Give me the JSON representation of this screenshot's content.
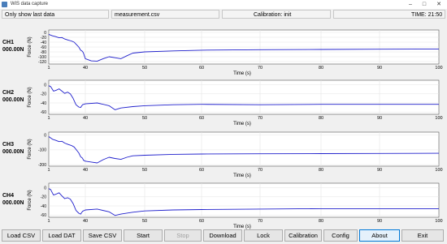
{
  "window": {
    "title": "WiS data capture",
    "minimize": "–",
    "maximize": "□",
    "close": "✕"
  },
  "status": {
    "mode": "Only show last data",
    "file": "measurement.csv",
    "calibration": "Calibration: init",
    "time": "TIME: 21:50"
  },
  "channels": [
    {
      "name": "CH1",
      "value": "000.00N",
      "ylabel": "Force (N)",
      "xlabel": "Time (s)",
      "yticks": [
        "0",
        "-20",
        "-40",
        "-60",
        "-80",
        "-100",
        "-120"
      ],
      "ylim": [
        -130,
        10
      ]
    },
    {
      "name": "CH2",
      "value": "000.00N",
      "ylabel": "Force (N)",
      "xlabel": "Time (s)",
      "yticks": [
        "0",
        "-20",
        "-40",
        "-60"
      ],
      "ylim": [
        -65,
        10
      ]
    },
    {
      "name": "CH3",
      "value": "000.00N",
      "ylabel": "Force (N)",
      "xlabel": "Time (s)",
      "yticks": [
        "0",
        "-100",
        "-200"
      ],
      "ylim": [
        -210,
        20
      ]
    },
    {
      "name": "CH4",
      "value": "000.00N",
      "ylabel": "Force (N)",
      "xlabel": "Time (s)",
      "yticks": [
        "0",
        "-20",
        "-40",
        "-60"
      ],
      "ylim": [
        -65,
        10
      ]
    }
  ],
  "xticks": [
    "1",
    "40",
    "50",
    "60",
    "70",
    "80",
    "90",
    "100"
  ],
  "colors": {
    "trace": "#1f1fcc",
    "grid": "#e4e4e4"
  },
  "buttons": [
    {
      "id": "load-csv",
      "label": "Load CSV"
    },
    {
      "id": "load-dat",
      "label": "Load DAT"
    },
    {
      "id": "save-csv",
      "label": "Save CSV"
    },
    {
      "id": "start",
      "label": "Start"
    },
    {
      "id": "stop",
      "label": "Stop"
    },
    {
      "id": "download",
      "label": "Download"
    },
    {
      "id": "lock",
      "label": "Lock"
    },
    {
      "id": "calibration",
      "label": "Calibration"
    },
    {
      "id": "config",
      "label": "Config"
    },
    {
      "id": "about",
      "label": "About"
    },
    {
      "id": "exit",
      "label": "Exit"
    }
  ],
  "chart_data": [
    {
      "type": "line",
      "title": "",
      "xlabel": "Time (s)",
      "ylabel": "Force (N)",
      "xlim": [
        1,
        100
      ],
      "ylim": [
        -130,
        10
      ],
      "series": [
        {
          "x": [
            1,
            5,
            8,
            12,
            15,
            18,
            22,
            25,
            28,
            31,
            33,
            35,
            37,
            38,
            40,
            41,
            42,
            43,
            44,
            45,
            46,
            47,
            48,
            50,
            55,
            60,
            70,
            80,
            90,
            100
          ],
          "y": [
            -8,
            -14,
            -17,
            -22,
            -21,
            -27,
            -32,
            -35,
            -40,
            -52,
            -60,
            -73,
            -78,
            -85,
            -108,
            -117,
            -118,
            -108,
            -100,
            -104,
            -108,
            -96,
            -85,
            -80,
            -76,
            -73,
            -71,
            -70,
            -69,
            -68
          ]
        }
      ]
    },
    {
      "type": "line",
      "title": "",
      "xlabel": "Time (s)",
      "ylabel": "Force (N)",
      "xlim": [
        1,
        100
      ],
      "ylim": [
        -65,
        10
      ],
      "series": [
        {
          "x": [
            1,
            3,
            6,
            9,
            12,
            15,
            18,
            21,
            24,
            27,
            30,
            33,
            35,
            37,
            40,
            42,
            44,
            45,
            46,
            48,
            50,
            55,
            60,
            70,
            80,
            90,
            100
          ],
          "y": [
            -2,
            -4,
            -14,
            -12,
            -9,
            -14,
            -19,
            -16,
            -20,
            -30,
            -44,
            -49,
            -50,
            -44,
            -42,
            -40,
            -46,
            -55,
            -51,
            -48,
            -46,
            -44,
            -43,
            -44,
            -43,
            -43,
            -43
          ]
        }
      ]
    },
    {
      "type": "line",
      "title": "",
      "xlabel": "Time (s)",
      "ylabel": "Force (N)",
      "xlim": [
        1,
        100
      ],
      "ylim": [
        -210,
        20
      ],
      "series": [
        {
          "x": [
            1,
            5,
            8,
            12,
            15,
            18,
            22,
            25,
            28,
            31,
            33,
            35,
            37,
            38,
            40,
            41,
            42,
            43,
            44,
            45,
            46,
            47,
            48,
            50,
            55,
            60,
            70,
            80,
            90,
            100
          ],
          "y": [
            -10,
            -28,
            -34,
            -44,
            -42,
            -54,
            -64,
            -70,
            -80,
            -104,
            -120,
            -146,
            -156,
            -170,
            -176,
            -182,
            -188,
            -166,
            -150,
            -158,
            -164,
            -150,
            -140,
            -136,
            -130,
            -128,
            -126,
            -125,
            -124,
            -123
          ]
        }
      ]
    },
    {
      "type": "line",
      "title": "",
      "xlabel": "Time (s)",
      "ylabel": "Force (N)",
      "xlim": [
        1,
        100
      ],
      "ylim": [
        -65,
        10
      ],
      "series": [
        {
          "x": [
            1,
            3,
            6,
            9,
            12,
            15,
            18,
            21,
            24,
            27,
            30,
            33,
            35,
            37,
            40,
            42,
            44,
            45,
            46,
            48,
            50,
            55,
            60,
            70,
            80,
            90,
            100
          ],
          "y": [
            -2,
            -4,
            -16,
            -14,
            -11,
            -18,
            -24,
            -22,
            -25,
            -35,
            -50,
            -56,
            -58,
            -52,
            -49,
            -47,
            -53,
            -61,
            -58,
            -54,
            -51,
            -49,
            -48,
            -47,
            -46,
            -46,
            -46
          ]
        }
      ]
    }
  ]
}
